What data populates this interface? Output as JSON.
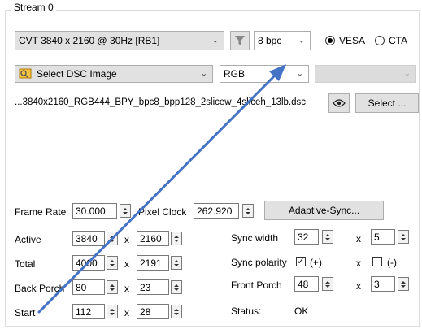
{
  "group": {
    "title": "Stream 0"
  },
  "row1": {
    "timing": "CVT 3840 x 2160 @ 30Hz [RB1]",
    "bpc": "8 bpc",
    "vesa_label": "VESA",
    "cta_label": "CTA",
    "vesa_selected": true
  },
  "row2": {
    "dsc_select": "Select DSC Image",
    "color_format": "RGB",
    "third_dropdown": ""
  },
  "row3": {
    "file_name": "...3840x2160_RGB444_BPY_bpc8_bpp128_2slicew_4sliceh_13lb.dsc",
    "select_button": "Select ..."
  },
  "frame": {
    "frame_rate_label": "Frame Rate",
    "frame_rate": "30.000",
    "pixel_clock_label": "Pixel Clock",
    "pixel_clock": "262.920",
    "adaptive_button": "Adaptive-Sync..."
  },
  "timings": {
    "active_label": "Active",
    "active_h": "3840",
    "active_v": "2160",
    "total_label": "Total",
    "total_h": "4000",
    "total_v": "2191",
    "back_porch_label": "Back Porch",
    "back_porch_h": "80",
    "back_porch_v": "23",
    "start_label": "Start",
    "start_h": "112",
    "start_v": "28",
    "x_sep": "x"
  },
  "sync": {
    "width_label": "Sync width",
    "width_h": "32",
    "width_v": "5",
    "polarity_label": "Sync polarity",
    "polarity_h_label": "(+)",
    "polarity_v_label": "(-)",
    "polarity_h_checked": true,
    "polarity_v_checked": false,
    "front_porch_label": "Front Porch",
    "front_porch_h": "48",
    "front_porch_v": "3",
    "status_label": "Status:",
    "status_value": "OK"
  },
  "colors": {
    "arrow": "#4472c4",
    "dsc_icon": "#e8a000"
  },
  "icons": {
    "filter": "filter-icon",
    "eye": "eye-icon",
    "dsc": "dsc-image-icon"
  }
}
